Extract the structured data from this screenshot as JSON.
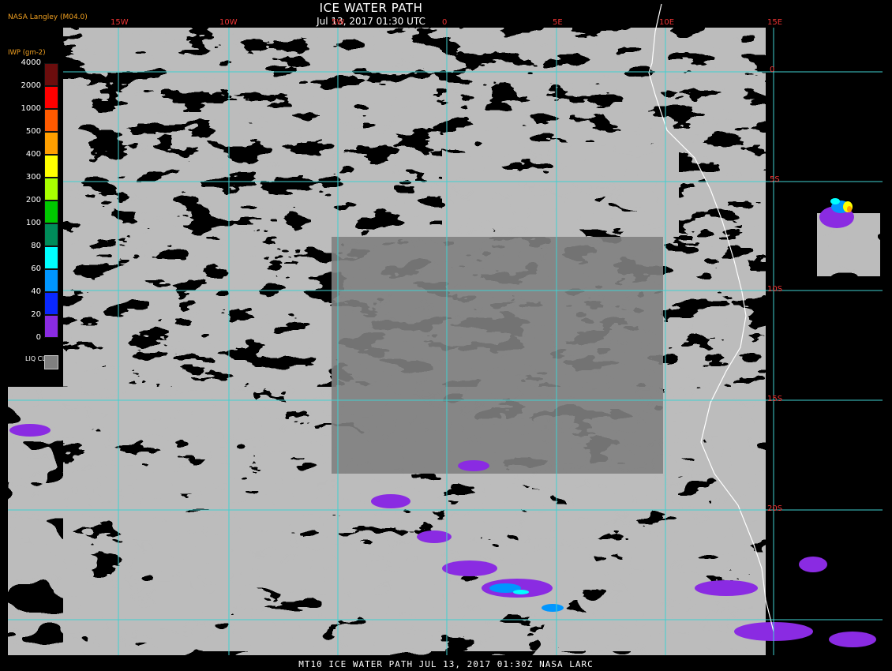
{
  "header": {
    "title": "ICE WATER PATH",
    "datetime": "Jul 13, 2017 01:30 UTC",
    "producer": "NASA Langley (M04.0)"
  },
  "footer": {
    "text": "MT10  ICE WATER PATH   JUL 13, 2017 01:30Z   NASA LARC"
  },
  "grid": {
    "longitudes": [
      "15W",
      "10W",
      "5W",
      "0",
      "5E",
      "10E",
      "15E"
    ],
    "latitudes": [
      "0",
      "5S",
      "10S",
      "15S",
      "20S"
    ],
    "line_color": "#40d0d0",
    "label_color": "#e03030"
  },
  "legend": {
    "title": "IWP (gm-2)",
    "values": [
      "4000",
      "2000",
      "1000",
      "500",
      "400",
      "300",
      "200",
      "100",
      "80",
      "60",
      "40",
      "20",
      "0"
    ],
    "colors": [
      "#6b0d0d",
      "#ff0000",
      "#ff5a00",
      "#ff9f00",
      "#ffff00",
      "#a8ff00",
      "#00c800",
      "#008c5a",
      "#00ffff",
      "#0096ff",
      "#0a28ff",
      "#8a2be2"
    ],
    "liquid_label": "LIQ CLD",
    "liquid_color": "#808080"
  },
  "colors": {
    "background": "#000000",
    "liquid_cloud": "#808080",
    "coast": "#ffffff",
    "ice_low": "#8a2be2",
    "ice_mid": "#00ffff"
  }
}
